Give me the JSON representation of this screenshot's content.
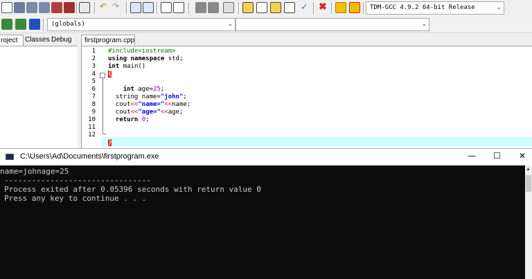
{
  "toolbar": {
    "compiler_select": "TDM-GCC 4.9.2 64-bit Release",
    "scope_select": "(globals)"
  },
  "left_panel": {
    "tabs": [
      "roject",
      "Classes",
      "Debug"
    ]
  },
  "editor": {
    "file_tab": "firstprogram.cpp",
    "line_numbers": [
      "1",
      "2",
      "3",
      "4",
      "5",
      "6",
      "7",
      "8",
      "9",
      "10",
      "11",
      "12"
    ]
  },
  "console": {
    "title": "C:\\Users\\Ad\\Documents\\firstprogram.exe",
    "minimize": "—",
    "maximize": "☐",
    "close": "✕",
    "lines": [
      "name=johnage=25",
      "--------------------------------",
      "Process exited after 0.05396 seconds with return value 0",
      "Press any key to continue . . ."
    ]
  },
  "colors": {
    "accent_red": "#ff0000",
    "current_line": "#ccffff",
    "string_blue": "#0000ff",
    "preprocessor_green": "#008000"
  }
}
